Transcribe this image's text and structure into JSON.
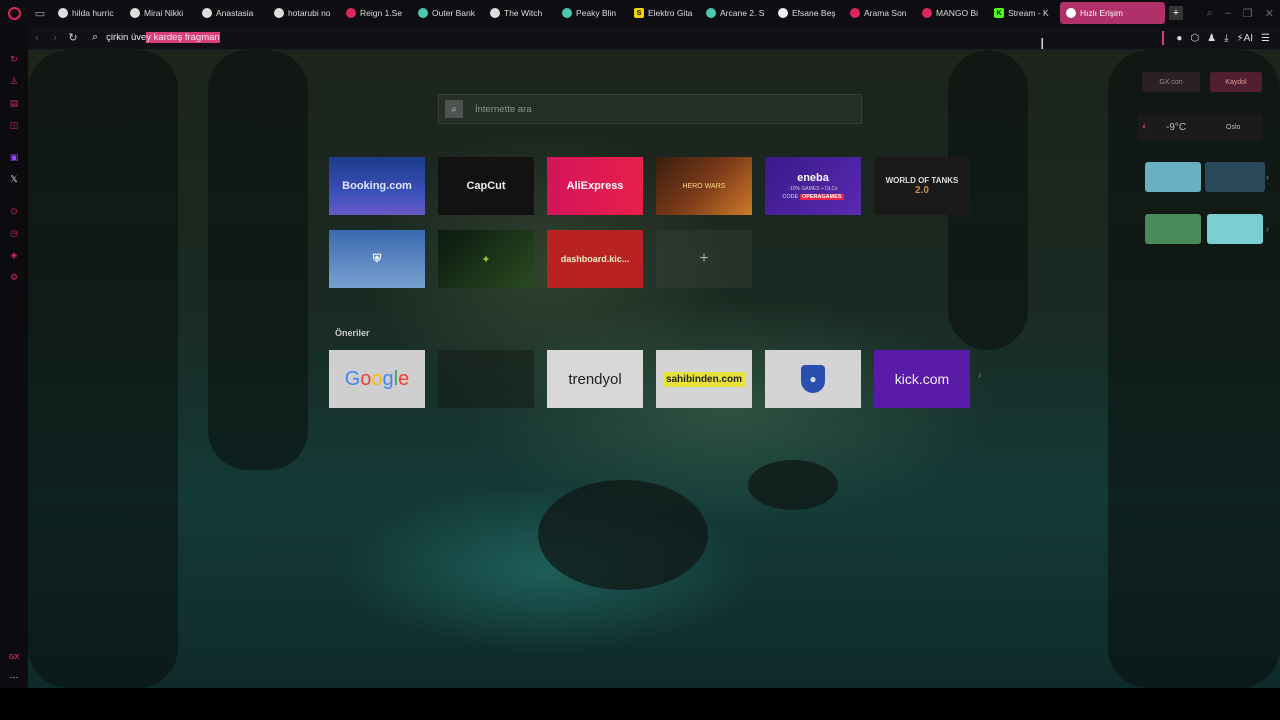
{
  "tabs": [
    {
      "label": "hilda hurric",
      "fav_color": "#dddddd",
      "fav_char": ""
    },
    {
      "label": "Mirai Nikki",
      "fav_color": "#dddddd",
      "fav_char": ""
    },
    {
      "label": "Anastasia",
      "fav_color": "#dddddd",
      "fav_char": ""
    },
    {
      "label": "hotarubi no",
      "fav_color": "#dddddd",
      "fav_char": ""
    },
    {
      "label": "Reign 1.Se",
      "fav_color": "#e0245e",
      "fav_char": ""
    },
    {
      "label": "Outer Bank",
      "fav_color": "#4ec9b0",
      "fav_char": ""
    },
    {
      "label": "The Witch",
      "fav_color": "#dddddd",
      "fav_char": ""
    },
    {
      "label": "Peaky Blin",
      "fav_color": "#4ec9b0",
      "fav_char": ""
    },
    {
      "label": "Elektro Gita",
      "fav_color": "#f5d400",
      "fav_char": "S"
    },
    {
      "label": "Arcane 2. S",
      "fav_color": "#4ec9b0",
      "fav_char": ""
    },
    {
      "label": "Efsane Beş",
      "fav_color": "#eeeeee",
      "fav_char": ""
    },
    {
      "label": "Arama Son",
      "fav_color": "#e0245e",
      "fav_char": ""
    },
    {
      "label": "MANGO Bi",
      "fav_color": "#e0245e",
      "fav_char": ""
    },
    {
      "label": "Stream - K",
      "fav_color": "#53fc18",
      "fav_char": "K"
    },
    {
      "label": "Hızlı Erişim",
      "fav_color": "#ffffff",
      "fav_char": "",
      "active": true
    }
  ],
  "address": {
    "text_plain": "çirkin üve",
    "text_selected": "y kardeş fragman"
  },
  "search": {
    "placeholder": "İnternette ara"
  },
  "speed_dial": {
    "booking": "Booking.com",
    "capcut": "CapCut",
    "aliexpress": "AliExpress",
    "game1": "HERO WARS",
    "eneba": "eneba",
    "eneba_sub": "-10% GAMES + DLCs",
    "eneba_code_label": "CODE",
    "eneba_code": "OPERAGAMES",
    "wot_line1": "WORLD OF TANKS",
    "wot_line2": "2.0",
    "kick_dashboard": "dashboard.kic...",
    "add": "+"
  },
  "suggestions": {
    "title": "Öneriler",
    "google": [
      "G",
      "o",
      "o",
      "g",
      "l",
      "e"
    ],
    "trendyol": "trendyol",
    "sahibinden": "sahibinden.com",
    "kick": "kick.com"
  },
  "widgets": {
    "pill1": "GX.con",
    "pill2": "Kaydol",
    "temperature": "-9°C",
    "city": "Oslo"
  },
  "sidebar_footer": "GX",
  "colors": {
    "accent": "#d63f7a",
    "opera_red": "#e0245e"
  }
}
